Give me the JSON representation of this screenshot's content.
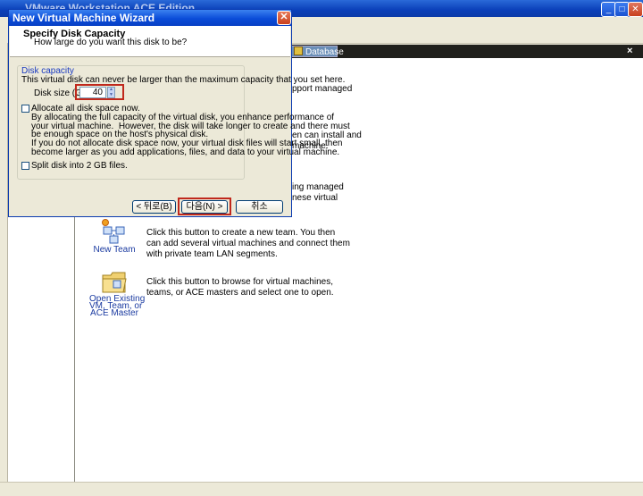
{
  "app": {
    "title": "VMware Workstation ACE Edition",
    "tab_database": "Database",
    "tab_close": "×",
    "partial_texts": [
      "pport managed",
      "en can install and\nmachine.",
      "ing managed\nnese virtual"
    ],
    "new_team": {
      "label": "New Team",
      "desc": "Click this button to create a new team. You then can add several virtual machines and connect them with private team LAN segments."
    },
    "open_existing": {
      "label": "Open Existing\nVM, Team, or\nACE Master",
      "desc": "Click this button to browse for virtual machines, teams, or ACE masters and select one to open."
    }
  },
  "dialog": {
    "title": "New Virtual Machine Wizard",
    "close": "✕",
    "heading": "Specify Disk Capacity",
    "subheading": "How large do you want this disk to be?",
    "group_label": "Disk capacity",
    "group_desc": "This virtual disk can never be larger than the maximum capacity that you set here.",
    "disk_size_label": "Disk size (GB):",
    "disk_size_value": "40",
    "allocate_label": "Allocate all disk space now.",
    "allocate_checked": false,
    "allocate_desc": "By allocating the full capacity of the virtual disk, you enhance performance of\nyour virtual machine.  However, the disk will take longer to create and there must\nbe enough space on the host's physical disk.",
    "allocate_desc2": "If you do not allocate disk space now, your virtual disk files will start small, then\nbecome larger as you add applications, files, and data to your virtual machine.",
    "split_label": "Split disk into 2 GB files.",
    "split_checked": false,
    "buttons": {
      "back": "< 뒤로(B)",
      "next": "다음(N) >",
      "cancel": "취소"
    }
  },
  "colors": {
    "highlight": "#c0281c",
    "titlebar": "#0a4cd8",
    "group_label": "#1a3ac0"
  }
}
